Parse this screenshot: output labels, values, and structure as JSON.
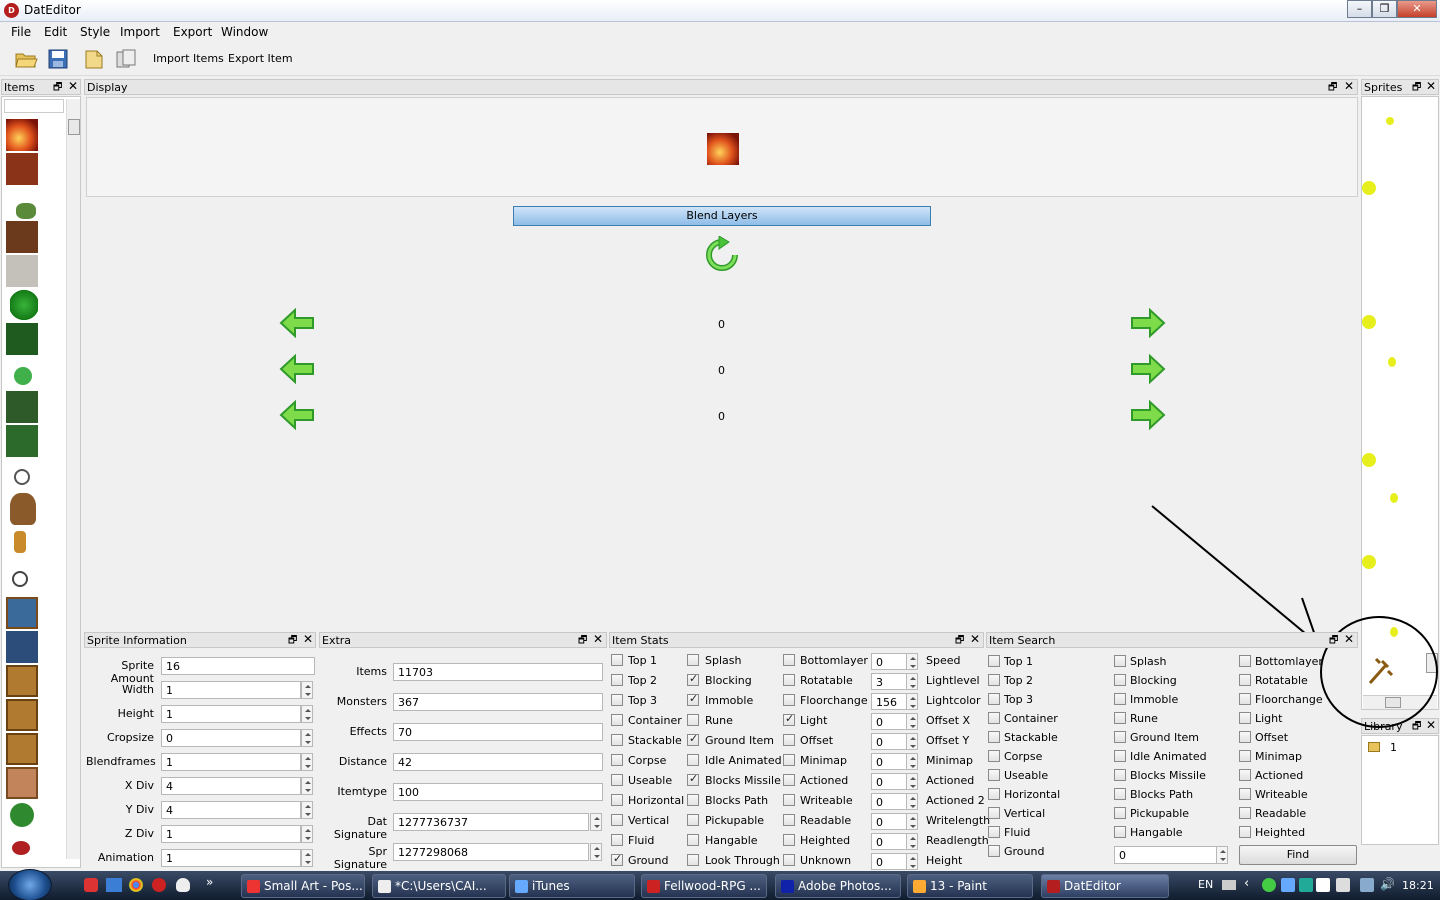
{
  "window": {
    "title": "DatEditor"
  },
  "menu": [
    "File",
    "Edit",
    "Style",
    "Import",
    "Export",
    "Window"
  ],
  "toolbar": {
    "import_items": "Import Items",
    "export_item": "Export Item"
  },
  "panels": {
    "items": "Items",
    "display": "Display",
    "sprites": "Sprites",
    "sprite_information": "Sprite Information",
    "extra": "Extra",
    "item_stats": "Item Stats",
    "item_search": "Item Search",
    "library": "Library"
  },
  "display": {
    "blend_layers": "Blend Layers",
    "values": [
      "0",
      "0",
      "0"
    ]
  },
  "sprite_info": [
    {
      "label": "Sprite Amount",
      "value": "16",
      "spin": false
    },
    {
      "label": "Width",
      "value": "1",
      "spin": true
    },
    {
      "label": "Height",
      "value": "1",
      "spin": true
    },
    {
      "label": "Cropsize",
      "value": "0",
      "spin": true
    },
    {
      "label": "Blendframes",
      "value": "1",
      "spin": true
    },
    {
      "label": "X Div",
      "value": "4",
      "spin": true
    },
    {
      "label": "Y Div",
      "value": "4",
      "spin": true
    },
    {
      "label": "Z Div",
      "value": "1",
      "spin": true
    },
    {
      "label": "Animation",
      "value": "1",
      "spin": true
    }
  ],
  "extra": [
    {
      "label": "Items",
      "value": "11703"
    },
    {
      "label": "Monsters",
      "value": "367"
    },
    {
      "label": "Effects",
      "value": "70"
    },
    {
      "label": "Distance",
      "value": "42"
    },
    {
      "label": "Itemtype",
      "value": "100"
    },
    {
      "label": "Dat Signature",
      "value": "1277736737"
    },
    {
      "label": "Spr Signature",
      "value": "1277298068"
    }
  ],
  "item_stats": {
    "col1": [
      {
        "label": "Top 1",
        "checked": false
      },
      {
        "label": "Top 2",
        "checked": false
      },
      {
        "label": "Top 3",
        "checked": false
      },
      {
        "label": "Container",
        "checked": false
      },
      {
        "label": "Stackable",
        "checked": false
      },
      {
        "label": "Corpse",
        "checked": false
      },
      {
        "label": "Useable",
        "checked": false
      },
      {
        "label": "Horizontal",
        "checked": false
      },
      {
        "label": "Vertical",
        "checked": false
      },
      {
        "label": "Fluid",
        "checked": false
      },
      {
        "label": "Ground",
        "checked": true
      }
    ],
    "col2": [
      {
        "label": "Splash",
        "checked": false
      },
      {
        "label": "Blocking",
        "checked": true
      },
      {
        "label": "Immoble",
        "checked": true
      },
      {
        "label": "Rune",
        "checked": false
      },
      {
        "label": "Ground Item",
        "checked": true
      },
      {
        "label": "Idle Animated",
        "checked": false
      },
      {
        "label": "Blocks Missile",
        "checked": true
      },
      {
        "label": "Blocks Path",
        "checked": false
      },
      {
        "label": "Pickupable",
        "checked": false
      },
      {
        "label": "Hangable",
        "checked": false
      },
      {
        "label": "Look Through",
        "checked": false
      }
    ],
    "col3": [
      {
        "label": "Bottomlayer",
        "checked": false
      },
      {
        "label": "Rotatable",
        "checked": false
      },
      {
        "label": "Floorchange",
        "checked": false
      },
      {
        "label": "Light",
        "checked": true
      },
      {
        "label": "Offset",
        "checked": false
      },
      {
        "label": "Minimap",
        "checked": false
      },
      {
        "label": "Actioned",
        "checked": false
      },
      {
        "label": "Writeable",
        "checked": false
      },
      {
        "label": "Readable",
        "checked": false
      },
      {
        "label": "Heighted",
        "checked": false
      },
      {
        "label": "Unknown",
        "checked": false
      }
    ],
    "spinners": [
      {
        "value": "0",
        "label": "Speed"
      },
      {
        "value": "3",
        "label": "Lightlevel"
      },
      {
        "value": "156",
        "label": "Lightcolor"
      },
      {
        "value": "0",
        "label": "Offset X"
      },
      {
        "value": "0",
        "label": "Offset Y"
      },
      {
        "value": "0",
        "label": "Minimap"
      },
      {
        "value": "0",
        "label": "Actioned"
      },
      {
        "value": "0",
        "label": "Actioned 2"
      },
      {
        "value": "0",
        "label": "Writelength"
      },
      {
        "value": "0",
        "label": "Readlength"
      },
      {
        "value": "0",
        "label": "Height"
      }
    ]
  },
  "item_search": {
    "col1": [
      "Top 1",
      "Top 2",
      "Top 3",
      "Container",
      "Stackable",
      "Corpse",
      "Useable",
      "Horizontal",
      "Vertical",
      "Fluid",
      "Ground"
    ],
    "col2": [
      "Splash",
      "Blocking",
      "Immoble",
      "Rune",
      "Ground Item",
      "Idle Animated",
      "Blocks Missile",
      "Blocks Path",
      "Pickupable",
      "Hangable"
    ],
    "col3": [
      "Bottomlayer",
      "Rotatable",
      "Floorchange",
      "Light",
      "Offset",
      "Minimap",
      "Actioned",
      "Writeable",
      "Readable",
      "Heighted"
    ],
    "value": "0",
    "find": "Find"
  },
  "library": {
    "item": "1"
  },
  "taskbar": {
    "tasks": [
      "Small Art - Pos...",
      "*C:\\Users\\CAI...",
      "iTunes",
      "Fellwood-RPG ...",
      "Adobe Photos...",
      "13 - Paint",
      "DatEditor"
    ],
    "lang": "EN",
    "time": "18:21"
  },
  "colors": {
    "accent_green": "#3fbf2a",
    "button_blue": "#a8cdf0",
    "sprite_yellow": "#e6ef1c"
  }
}
